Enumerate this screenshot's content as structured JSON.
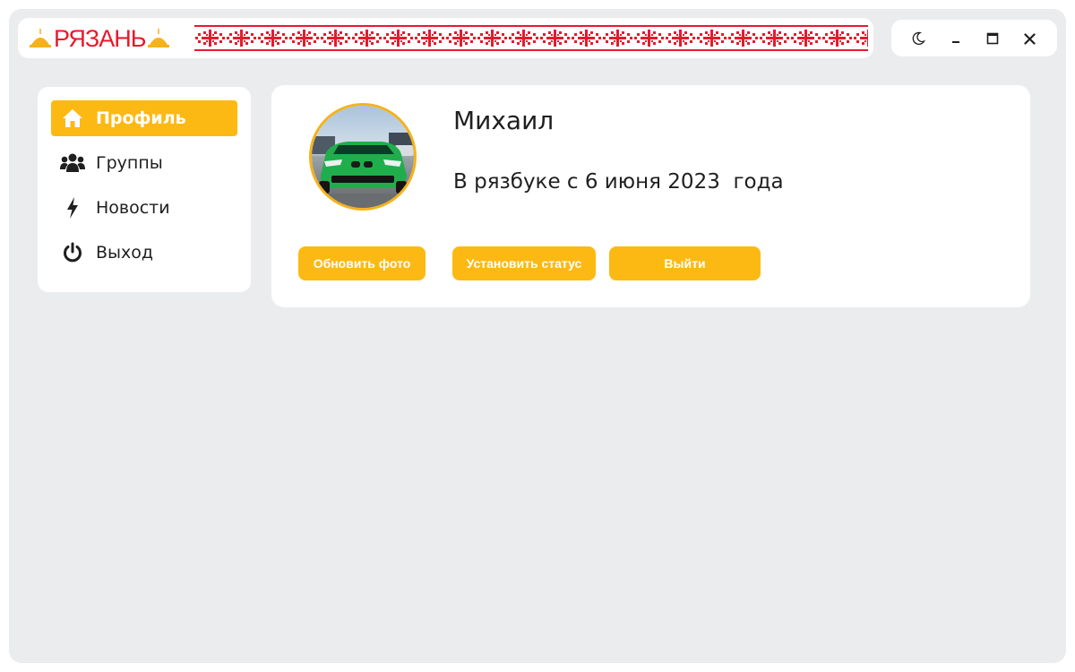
{
  "header": {
    "logo_text": "РЯЗАНЬ",
    "accent_color": "#fdb913",
    "logo_color": "#e8192c"
  },
  "window_controls": {
    "theme_icon": "moon-icon",
    "minimize_icon": "minimize-icon",
    "maximize_icon": "maximize-icon",
    "close_icon": "close-icon"
  },
  "sidebar": {
    "items": [
      {
        "label": "Профиль",
        "icon": "home-icon",
        "active": true
      },
      {
        "label": "Группы",
        "icon": "users-icon",
        "active": false
      },
      {
        "label": "Новости",
        "icon": "bolt-icon",
        "active": false
      },
      {
        "label": "Выход",
        "icon": "power-icon",
        "active": false
      }
    ]
  },
  "profile": {
    "name": "Михаил",
    "member_since": "В рязбуке с 6 июня 2023  года",
    "avatar_icon": "car-photo",
    "buttons": {
      "update_photo": "Обновить фото",
      "set_status": "Установить статус",
      "logout": "Выйти"
    }
  }
}
